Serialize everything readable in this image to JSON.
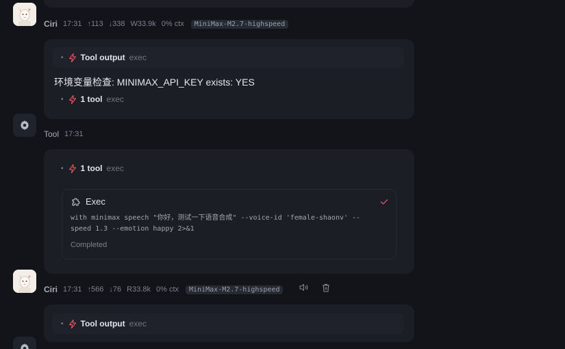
{
  "messages": [
    {
      "author": "Ciri",
      "time": "17:31",
      "stats": [
        "↑113",
        "↓338",
        "W33.9k",
        "0% ctx"
      ],
      "model": "MiniMax-M2.7-highspeed"
    },
    {
      "author": "Tool",
      "time": "17:31"
    },
    {
      "author": "Ciri",
      "time": "17:31",
      "stats": [
        "↑566",
        "↓76",
        "R33.8k",
        "0% ctx"
      ],
      "model": "MiniMax-M2.7-highspeed"
    }
  ],
  "card1": {
    "tool_output_title": "Tool output",
    "tool_output_sub": "exec",
    "body_text": "环境变量检查: MINIMAX_API_KEY exists: YES",
    "tool_count_title": "1 tool",
    "tool_count_sub": "exec"
  },
  "card2": {
    "tool_count_title": "1 tool",
    "tool_count_sub": "exec",
    "exec_title": "Exec",
    "command": "with minimax speech \"你好，测试一下语音合成\" --voice-id 'female-shaonv' --speed 1.3 --emotion happy 2>&1",
    "command_line1": "with minimax speech \"你好，测试一下语音合成\" --voice-id 'female-shaonv' --",
    "command_line2": "speed 1.3 --emotion happy 2>&1",
    "status": "Completed"
  },
  "card3": {
    "tool_output_title": "Tool output",
    "tool_output_sub": "exec"
  },
  "colors": {
    "background": "#12141a",
    "card": "#1b1e25",
    "accent_bolt": "#e0525b",
    "check": "#d9545c"
  },
  "icons": [
    "bolt-icon",
    "gear-icon",
    "puzzle-icon",
    "check-icon",
    "speaker-icon",
    "trash-icon",
    "avatar"
  ]
}
